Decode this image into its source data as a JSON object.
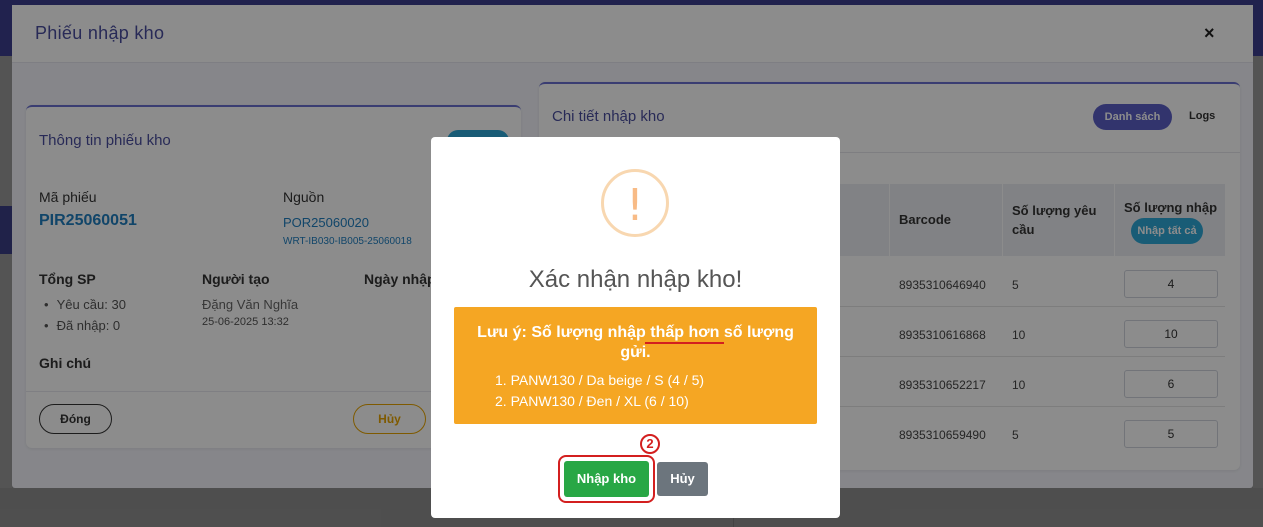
{
  "modal": {
    "title": "Phiếu nhập kho",
    "close_symbol": "×"
  },
  "info_card": {
    "title": "Thông tin phiếu kho",
    "code_label": "Mã phiếu",
    "code_value": "PIR25060051",
    "source_label": "Nguồn",
    "source_value": "POR25060020",
    "source_ref": "WRT-IB030-IB005-25060018",
    "total_label": "Tổng SP",
    "total_requested": "Yêu cầu: 30",
    "total_received": "Đã nhập: 0",
    "creator_label": "Người tạo",
    "creator_name": "Đặng Văn Nghĩa",
    "created_at": "25-06-2025 13:32",
    "date_label": "Ngày nhập",
    "note_label": "Ghi chú",
    "close_button": "Đóng",
    "cancel_button": "Hủy"
  },
  "detail_card": {
    "title": "Chi tiết nhập kho",
    "tab_list": "Danh sách",
    "tab_logs": "Logs",
    "columns": {
      "barcode": "Barcode",
      "requested": "Số lượng yêu cầu",
      "received": "Số lượng nhập",
      "receive_all": "Nhập tất cả"
    },
    "rows": [
      {
        "barcode": "8935310646940",
        "requested": "5",
        "received": "4"
      },
      {
        "barcode": "8935310616868",
        "requested": "10",
        "received": "10"
      },
      {
        "barcode": "8935310652217",
        "requested": "10",
        "received": "6"
      },
      {
        "barcode": "8935310659490",
        "requested": "5",
        "received": "5"
      }
    ]
  },
  "dialog": {
    "icon": "warning-icon",
    "icon_symbol": "!",
    "title": "Xác nhận nhập kho!",
    "notice_line1": "Lưu ý: Số lượng nhập thấp hơn số lượng",
    "notice_line2": "gửi.",
    "items": [
      "1. PANW130 / Da beige / S (4 / 5)",
      "2. PANW130 / Đen / XL (6 / 10)"
    ],
    "step_marker": "2",
    "confirm_button": "Nhập kho",
    "cancel_button": "Hủy"
  },
  "colors": {
    "accent": "#5b5fc7",
    "notice": "#f5a623",
    "confirm": "#28a745",
    "highlight": "#d31f1f"
  }
}
